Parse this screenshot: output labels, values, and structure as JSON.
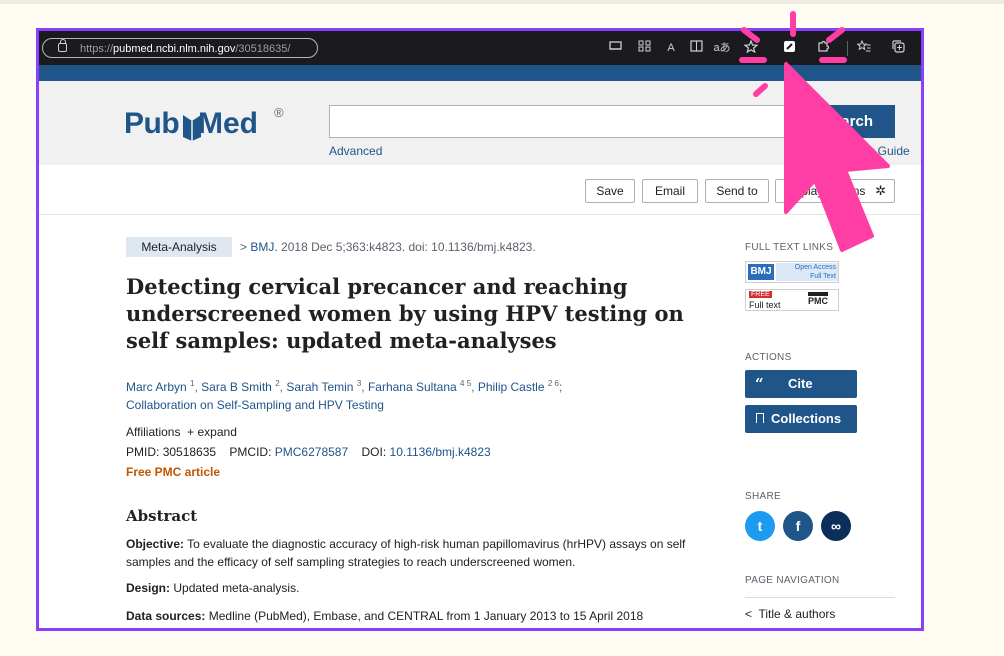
{
  "browser": {
    "url_prefix": "https://",
    "url_domain": "pubmed.ncbi.nlm.nih.gov",
    "url_path": "/30518635/",
    "toolbar_icons": [
      "tab-actions-icon",
      "apps-icon",
      "read-aloud-icon",
      "immersive-reader-icon",
      "translate-icon",
      "add-favorite-icon",
      "active-extension-icon",
      "extensions-icon",
      "favorites-icon",
      "collections-icon"
    ],
    "toolbar_glyphs": {
      "read_aloud": "A",
      "translate": "aあ"
    }
  },
  "header": {
    "logo_text_1": "Pub",
    "logo_text_2": "Med",
    "logo_registered": "®",
    "search_value": "",
    "search_button": "Search",
    "advanced_link": "Advanced",
    "user_guide_link": "User Guide"
  },
  "toolbar": {
    "save": "Save",
    "email": "Email",
    "send_to": "Send to",
    "display_options": "Display options"
  },
  "article": {
    "type_tag": "Meta-Analysis",
    "cite_arrow": ">",
    "journal": "BMJ.",
    "citation": "2018 Dec 5;363:k4823. doi: 10.1136/bmj.k4823.",
    "title": "Detecting cervical precancer and reaching underscreened women by using HPV testing on self samples: updated meta-analyses",
    "authors": [
      {
        "name": "Marc Arbyn",
        "sup": "1"
      },
      {
        "name": "Sara B Smith",
        "sup": "2"
      },
      {
        "name": "Sarah Temin",
        "sup": "3"
      },
      {
        "name": "Farhana Sultana",
        "sup": "4 5"
      },
      {
        "name": "Philip Castle",
        "sup": "2 6"
      }
    ],
    "collaboration": "Collaboration on Self-Sampling and HPV Testing",
    "affiliations_label": "Affiliations",
    "expand_label": "+ expand",
    "pmid_label": "PMID:",
    "pmid": "30518635",
    "pmcid_label": "PMCID:",
    "pmcid": "PMC6278587",
    "doi_label": "DOI:",
    "doi": "10.1136/bmj.k4823",
    "free_pmc": "Free PMC article"
  },
  "abstract": {
    "heading": "Abstract",
    "sections": [
      {
        "label": "Objective:",
        "text": "To evaluate the diagnostic accuracy of high-risk human papillomavirus (hrHPV) assays on self samples and the efficacy of self sampling strategies to reach underscreened women."
      },
      {
        "label": "Design:",
        "text": "Updated meta-analysis."
      },
      {
        "label": "Data sources:",
        "text": "Medline (PubMed), Embase, and CENTRAL from 1 January 2013 to 15 April 2018"
      }
    ]
  },
  "sidebar": {
    "full_text_links": "FULL TEXT LINKS",
    "bmj_logo": "BMJ",
    "open_access_1": "Open Access",
    "open_access_2": "Full Text",
    "free_label": "FREE",
    "full_text_label": "Full text",
    "pmc_label": "PMC",
    "actions": "ACTIONS",
    "cite_icon": "“",
    "cite": "Cite",
    "collections": "Collections",
    "share": "SHARE",
    "share_glyphs": {
      "twitter": "t",
      "facebook": "f",
      "link": "∞"
    },
    "page_navigation": "PAGE NAVIGATION",
    "nav_arrow": "<",
    "title_authors": "Title & authors"
  },
  "colors": {
    "frame": "#8a3ffc",
    "pubmed_blue": "#20558a",
    "cursor_pink": "#ff3ea5",
    "free_orange": "#c05600"
  }
}
